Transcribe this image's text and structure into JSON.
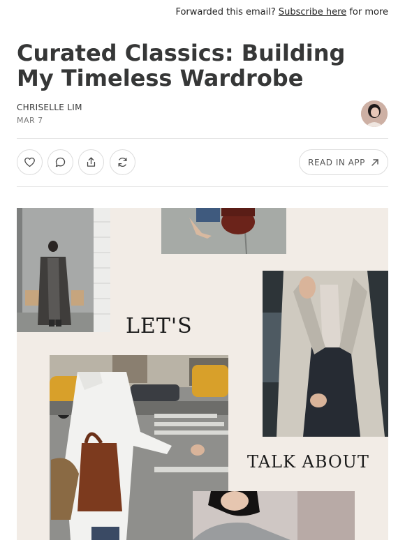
{
  "forward_bar": {
    "prefix": "Forwarded this email?",
    "link": "Subscribe here",
    "suffix": "for more"
  },
  "post": {
    "title": "Curated Classics: Building My Timeless Wardrobe",
    "author": "CHRISELLE LIM",
    "date": "MAR 7"
  },
  "actions": {
    "like_icon": "heart-icon",
    "comment_icon": "comment-icon",
    "share_icon": "share-icon",
    "restack_icon": "restack-icon",
    "read_in_app_label": "READ IN APP",
    "read_in_app_icon": "arrow-up-right-icon"
  },
  "collage": {
    "text_1": "LET'S",
    "text_2": "TALK ABOUT"
  },
  "colors": {
    "title": "#363737",
    "collage_background": "#f2ece6",
    "border": "#dcdcdc"
  }
}
